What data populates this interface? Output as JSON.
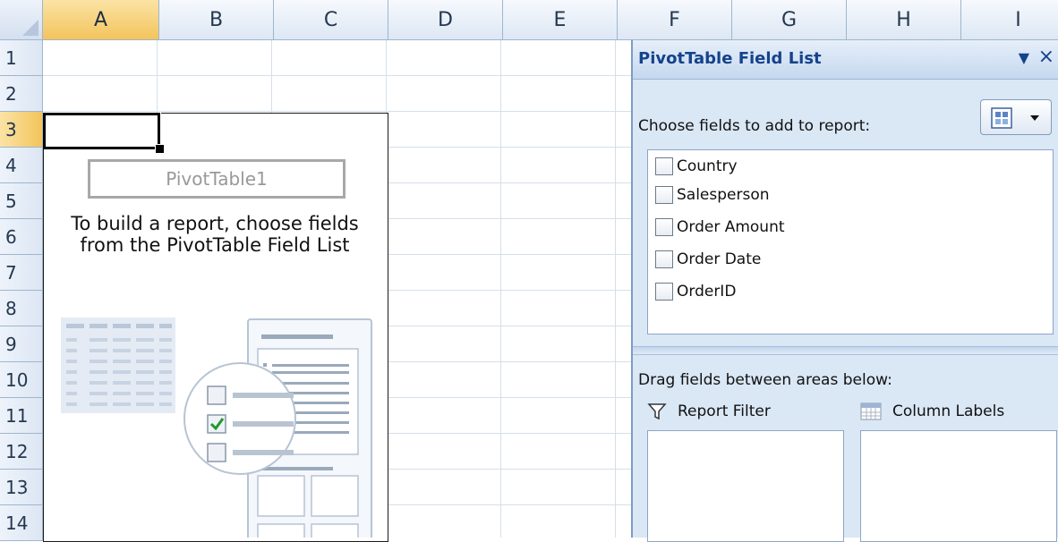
{
  "columns": [
    "A",
    "B",
    "C",
    "D",
    "E",
    "F",
    "G",
    "H",
    "I"
  ],
  "selected_column": "A",
  "rows": [
    "1",
    "2",
    "3",
    "4",
    "5",
    "6",
    "7",
    "8",
    "9",
    "10",
    "11",
    "12",
    "13",
    "14"
  ],
  "selected_row": "3",
  "pivot": {
    "name": "PivotTable1",
    "instructions": "To build a report, choose fields from the PivotTable Field List"
  },
  "field_list": {
    "title": "PivotTable Field List",
    "choose_label": "Choose fields to add to report:",
    "fields": [
      {
        "label": "Country",
        "checked": false
      },
      {
        "label": "Salesperson",
        "checked": false
      },
      {
        "label": "Order Amount",
        "checked": false
      },
      {
        "label": "Order Date",
        "checked": false
      },
      {
        "label": "OrderID",
        "checked": false
      }
    ],
    "drag_label": "Drag fields between areas below:",
    "areas": {
      "report_filter": "Report Filter",
      "column_labels": "Column Labels"
    }
  },
  "colors": {
    "header_gradient": "#dde7f4",
    "selected_header": "#f3c45c",
    "pane_background": "#dae7f5",
    "title_text": "#15428b"
  }
}
